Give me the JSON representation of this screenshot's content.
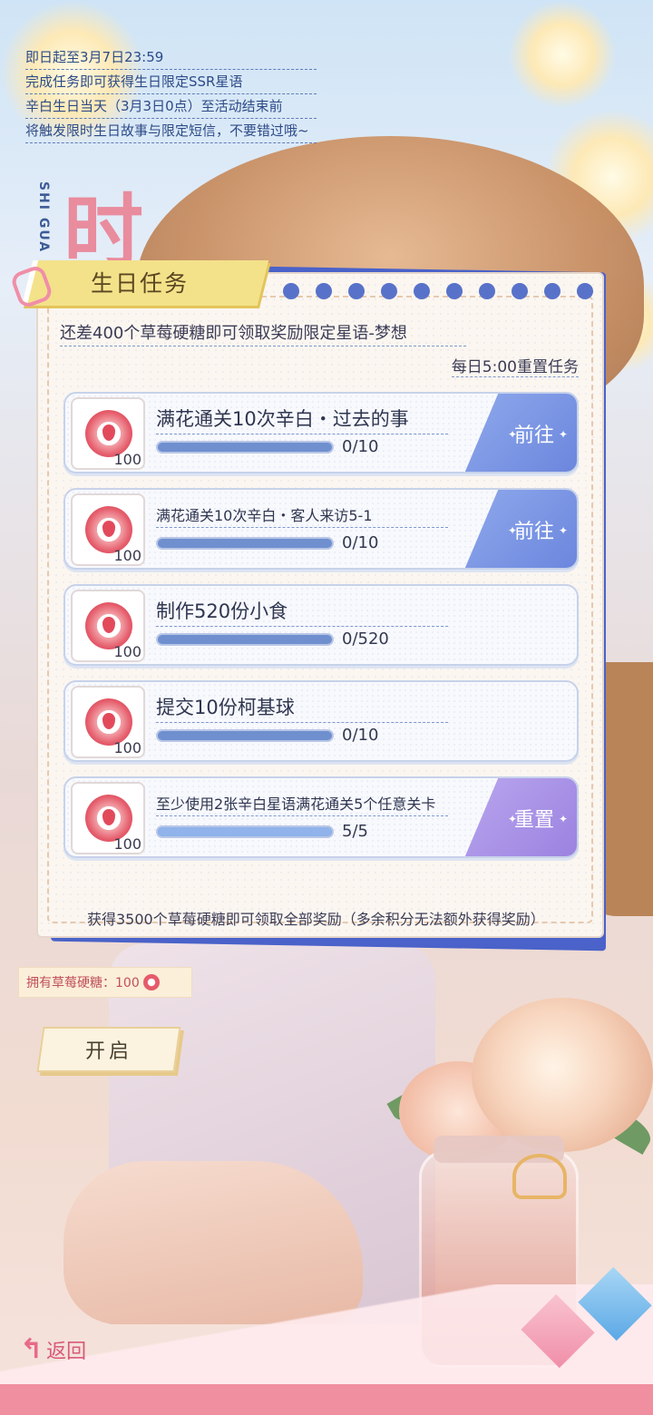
{
  "info_lines": [
    "即日起至3月7日23:59",
    "完成任务即可获得生日限定SSR星语",
    "辛白生日当天（3月3日0点）至活动结束前",
    "将触发限时生日故事与限定短信，不要错过哦~"
  ],
  "side_vertical_text": "SHI GUA",
  "side_big_char": "时",
  "panel": {
    "title": "生日任务",
    "remaining_note": "还差400个草莓硬糖即可领取奖励限定星语-梦想",
    "reset_note": "每日5:00重置任务",
    "footer_note": "获得3500个草莓硬糖即可领取全部奖励（多余积分无法额外获得奖励）"
  },
  "tasks": [
    {
      "name": "满花通关10次辛白・过去的事",
      "reward": "100",
      "progress": "0/10",
      "fraction": 0,
      "button": "前往",
      "button_style": "blue"
    },
    {
      "name": "满花通关10次辛白・客人来访5-1",
      "reward": "100",
      "progress": "0/10",
      "fraction": 0,
      "button": "前往",
      "button_style": "blue"
    },
    {
      "name": "制作520份小食",
      "reward": "100",
      "progress": "0/520",
      "fraction": 0,
      "button": "",
      "button_style": "none"
    },
    {
      "name": "提交10份柯基球",
      "reward": "100",
      "progress": "0/10",
      "fraction": 0,
      "button": "",
      "button_style": "none"
    },
    {
      "name": "至少使用2张辛白星语满花通关5个任意关卡",
      "reward": "100",
      "progress": "5/5",
      "fraction": 1,
      "button": "重置",
      "button_style": "purple"
    }
  ],
  "owned": {
    "label": "拥有草莓硬糖：100"
  },
  "start_button": "开启",
  "back_button": "返回",
  "icons": [
    "strawberry-candy-icon",
    "back-arrow-icon",
    "sparkle-icon"
  ]
}
